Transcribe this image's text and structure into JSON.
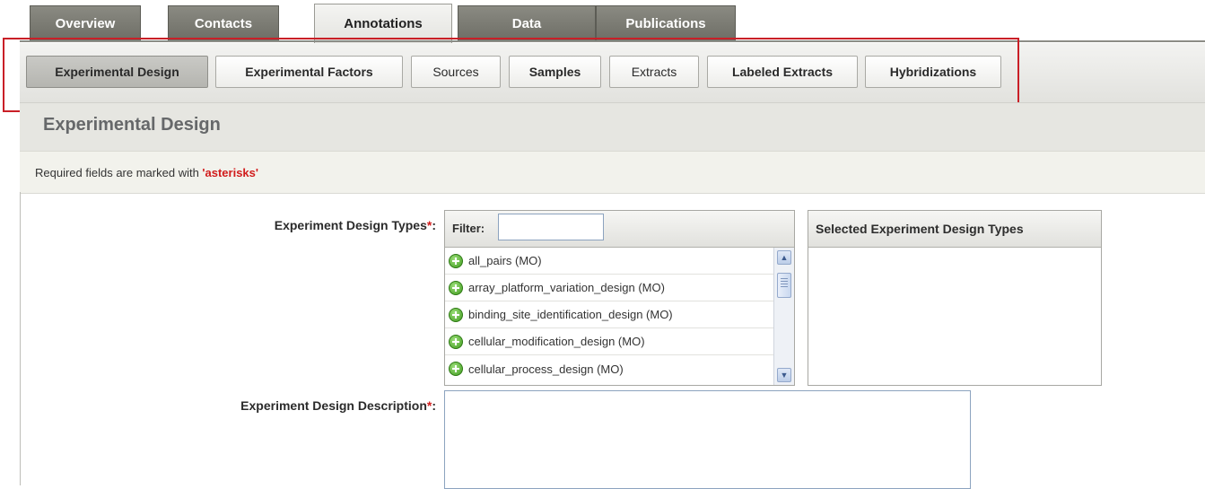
{
  "top_tabs": [
    "Overview",
    "Contacts",
    "Annotations",
    "Data",
    "Publications"
  ],
  "sub_tabs": [
    "Experimental Design",
    "Experimental Factors",
    "Sources",
    "Samples",
    "Extracts",
    "Labeled Extracts",
    "Hybridizations"
  ],
  "section": {
    "title": "Experimental Design",
    "required_prefix": "Required fields are marked with ",
    "required_word": "'asterisks'"
  },
  "design_types": {
    "label": "Experiment Design Types",
    "star": "*",
    "colon": ":",
    "filter_label": "Filter:",
    "filter_value": "",
    "items": [
      "all_pairs (MO)",
      "array_platform_variation_design (MO)",
      "binding_site_identification_design (MO)",
      "cellular_modification_design (MO)",
      "cellular_process_design (MO)"
    ],
    "selected_header": "Selected Experiment Design Types"
  },
  "description": {
    "label": "Experiment Design Description",
    "star": "*",
    "colon": ":",
    "value": ""
  }
}
